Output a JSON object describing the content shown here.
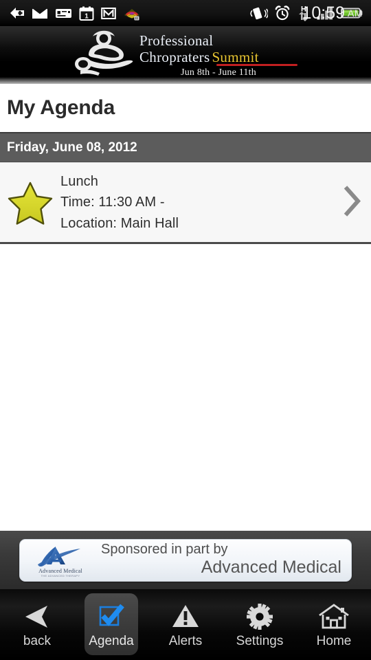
{
  "statusbar": {
    "icons_left": [
      {
        "name": "download-arrow-icon"
      },
      {
        "name": "email-envelope-icon"
      },
      {
        "name": "sms-message-icon"
      },
      {
        "name": "calendar-icon",
        "label": "1"
      },
      {
        "name": "gmail-icon"
      },
      {
        "name": "media-rainbow-icon"
      }
    ],
    "icons_right": [
      {
        "name": "vibrate-icon"
      },
      {
        "name": "alarm-clock-icon"
      },
      {
        "name": "hspa-data-icon",
        "label": "H"
      },
      {
        "name": "signal-bars-icon"
      },
      {
        "name": "battery-icon"
      }
    ],
    "time": "10:59",
    "meridiem": "AM"
  },
  "header": {
    "logo_icon": "chiropractor-logo-icon",
    "line1": "Professional",
    "line2": "Chropraters",
    "line2_accent": "Summit",
    "dates": "Jun 8th - June 11th",
    "accent_color": "#e8c531",
    "underline_color": "#c21f20"
  },
  "page": {
    "title": "My Agenda"
  },
  "agenda": {
    "date_header": "Friday, June 08, 2012",
    "items": [
      {
        "star_icon": "favorite-star-icon",
        "title": "Lunch",
        "time": "Time: 11:30 AM -",
        "location": "Location: Main Hall",
        "chevron_icon": "chevron-right-icon"
      }
    ]
  },
  "sponsor": {
    "logo_icon": "advanced-medical-logo-icon",
    "logo_name": "Advanced Medical",
    "logo_tagline": "THE ADVANCED THERAPY",
    "line1": "Sponsored in part by",
    "line2": "Advanced Medical"
  },
  "navbar": {
    "items": [
      {
        "name": "back",
        "label": "back",
        "icon": "back-arrow-icon",
        "selected": false
      },
      {
        "name": "agenda",
        "label": "Agenda",
        "icon": "checkbox-check-icon",
        "selected": true
      },
      {
        "name": "alerts",
        "label": "Alerts",
        "icon": "warning-triangle-icon",
        "selected": false
      },
      {
        "name": "settings",
        "label": "Settings",
        "icon": "gear-icon",
        "selected": false
      },
      {
        "name": "home",
        "label": "Home",
        "icon": "house-icon",
        "selected": false
      }
    ]
  }
}
